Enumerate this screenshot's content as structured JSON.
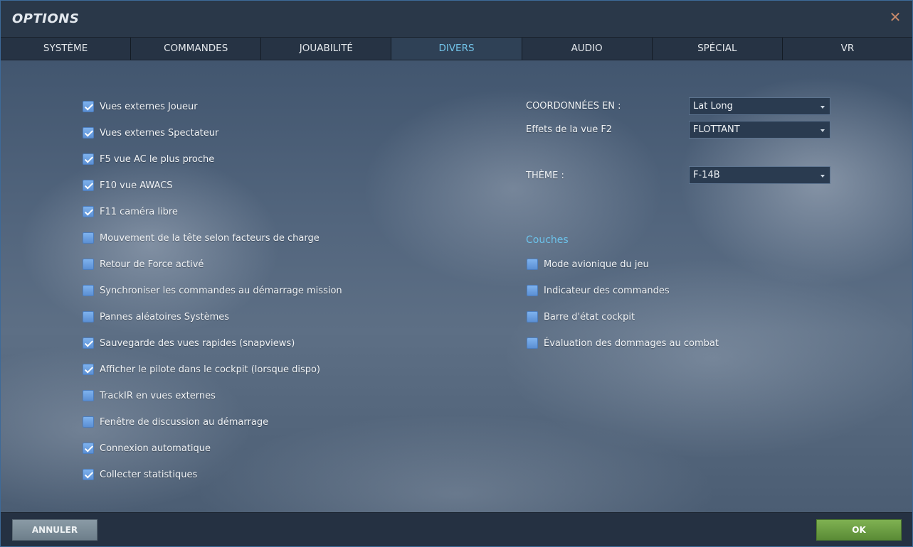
{
  "window": {
    "title": "OPTIONS"
  },
  "tabs": [
    {
      "label": "SYSTÈME",
      "active": false
    },
    {
      "label": "COMMANDES",
      "active": false
    },
    {
      "label": "JOUABILITÉ",
      "active": false
    },
    {
      "label": "DIVERS",
      "active": true
    },
    {
      "label": "AUDIO",
      "active": false
    },
    {
      "label": "SPÉCIAL",
      "active": false
    },
    {
      "label": "VR",
      "active": false
    }
  ],
  "left_options": [
    {
      "label": "Vues externes Joueur",
      "checked": true
    },
    {
      "label": "Vues externes Spectateur",
      "checked": true
    },
    {
      "label": "F5 vue AC le plus proche",
      "checked": true
    },
    {
      "label": "F10 vue AWACS",
      "checked": true
    },
    {
      "label": "F11 caméra libre",
      "checked": true
    },
    {
      "label": "Mouvement de la tête selon facteurs de charge",
      "checked": false
    },
    {
      "label": "Retour de Force activé",
      "checked": false
    },
    {
      "label": "Synchroniser les commandes au démarrage mission",
      "checked": false
    },
    {
      "label": "Pannes aléatoires Systèmes",
      "checked": false
    },
    {
      "label": "Sauvegarde des vues rapides (snapviews)",
      "checked": true
    },
    {
      "label": "Afficher le pilote dans le cockpit (lorsque dispo)",
      "checked": true
    },
    {
      "label": "TrackIR en vues externes",
      "checked": false
    },
    {
      "label": "Fenêtre de discussion au démarrage",
      "checked": false
    },
    {
      "label": "Connexion automatique",
      "checked": true
    },
    {
      "label": "Collecter statistiques",
      "checked": true
    }
  ],
  "fields": {
    "coordinates": {
      "label": "COORDONNÉES EN :",
      "value": "Lat Long"
    },
    "f2_effects": {
      "label": "Effets de la vue F2",
      "value": "FLOTTANT"
    },
    "theme": {
      "label": "THÈME :",
      "value": "F-14B"
    }
  },
  "layers": {
    "title": "Couches",
    "options": [
      {
        "label": "Mode avionique du jeu",
        "checked": false
      },
      {
        "label": "Indicateur des commandes",
        "checked": false
      },
      {
        "label": "Barre d'état cockpit",
        "checked": false
      },
      {
        "label": "Évaluation des dommages au combat",
        "checked": false
      }
    ]
  },
  "footer": {
    "cancel_label": "ANNULER",
    "ok_label": "OK"
  }
}
